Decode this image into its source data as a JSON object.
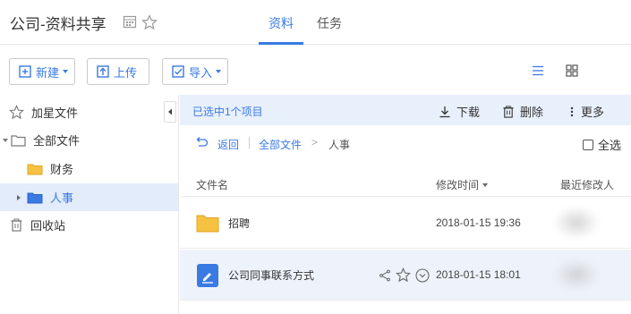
{
  "header": {
    "title": "公司-资料共享",
    "tabs": [
      {
        "label": "资料",
        "active": true
      },
      {
        "label": "任务",
        "active": false
      }
    ]
  },
  "toolbar": {
    "new_label": "新建",
    "upload_label": "上传",
    "import_label": "导入",
    "accent": "#3a7ae3"
  },
  "sidebar": {
    "items": [
      {
        "label": "加星文件",
        "icon": "star-outline-icon"
      },
      {
        "label": "全部文件",
        "icon": "folder-outline-icon"
      },
      {
        "label": "财务",
        "icon": "folder-yellow-icon"
      },
      {
        "label": "人事",
        "icon": "folder-blue-icon",
        "selected": true
      },
      {
        "label": "回收站",
        "icon": "trash-icon"
      }
    ]
  },
  "selection_bar": {
    "text": "已选中1个项目",
    "download_label": "下载",
    "delete_label": "删除",
    "more_label": "更多"
  },
  "breadcrumb": {
    "back_label": "返回",
    "root_label": "全部文件",
    "separator": ">",
    "current_label": "人事",
    "select_all_label": "全选"
  },
  "table": {
    "headers": {
      "name": "文件名",
      "modified": "修改时间",
      "modifier": "最近修改人"
    },
    "rows": [
      {
        "name": "招聘",
        "modified": "2018-01-15 19:36",
        "type": "folder"
      },
      {
        "name": "公司同事联系方式",
        "modified": "2018-01-15 18:01",
        "type": "document",
        "highlighted": true
      }
    ]
  }
}
